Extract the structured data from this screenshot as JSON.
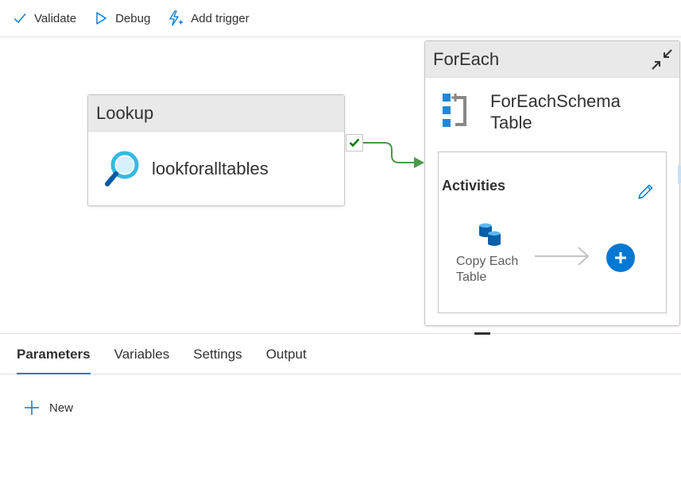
{
  "toolbar": {
    "validate_label": "Validate",
    "debug_label": "Debug",
    "add_trigger_label": "Add trigger"
  },
  "canvas": {
    "lookup": {
      "type_label": "Lookup",
      "name": "lookforalltables"
    },
    "foreach": {
      "type_label": "ForEach",
      "name": "ForEachSchema Table",
      "activities_label": "Activities",
      "inner_activity": {
        "label": "Copy Each Table"
      }
    }
  },
  "bottom_panel": {
    "tabs": [
      {
        "label": "Parameters",
        "active": true
      },
      {
        "label": "Variables",
        "active": false
      },
      {
        "label": "Settings",
        "active": false
      },
      {
        "label": "Output",
        "active": false
      }
    ],
    "new_label": "New"
  },
  "colors": {
    "accent": "#0078d4",
    "success": "#107c10",
    "connector": "#4a9a4a",
    "header_bg": "#e9e9e9"
  },
  "icons": {
    "validate": "checkmark-icon",
    "debug": "play-outline-icon",
    "add_trigger": "lightning-plus-icon",
    "lookup": "magnifier-icon",
    "foreach": "foreach-loop-icon",
    "collapse": "collapse-arrows-icon",
    "edit": "pencil-icon",
    "copy": "database-copy-icon",
    "add": "plus-circle-icon",
    "new": "plus-icon"
  }
}
